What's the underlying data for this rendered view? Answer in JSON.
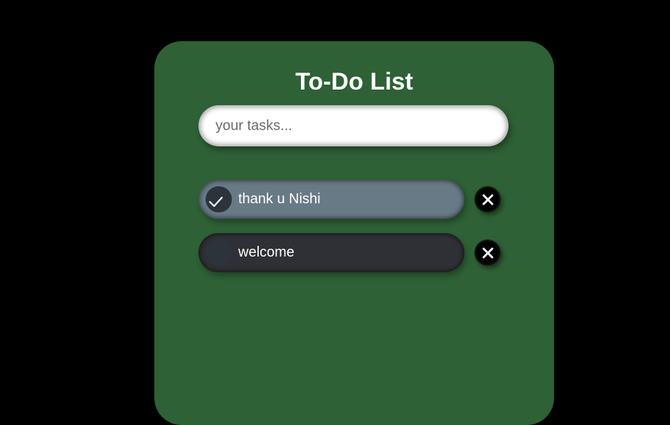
{
  "app": {
    "title": "To-Do List"
  },
  "input": {
    "placeholder": "your tasks...",
    "value": ""
  },
  "tasks": [
    {
      "text": "thank u Nishi",
      "done": true,
      "check_icon": "checkmark-icon",
      "delete_icon": "close-icon"
    },
    {
      "text": "welcome",
      "done": false,
      "check_icon": "checkmark-icon",
      "delete_icon": "close-icon"
    }
  ],
  "colors": {
    "page_background": "#000000",
    "card_background": "#2e6135",
    "task_done_background": "#687a86",
    "task_pending_background": "#2e3035",
    "delete_button_background": "#000000"
  }
}
